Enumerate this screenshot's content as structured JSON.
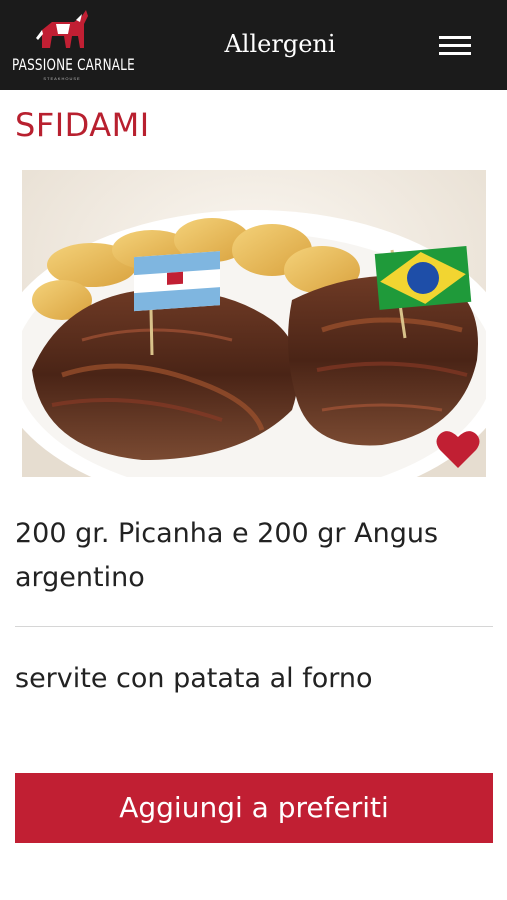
{
  "header": {
    "logo_text": "PASSIONE CARNALE",
    "logo_subtext": "STEAKHOUSE",
    "title": "Allergeni",
    "menu_icon": "hamburger-menu-icon"
  },
  "product": {
    "title": "SFIDAMI",
    "image_alt": "Picanha e Angus argentino con patate al forno",
    "favorite_icon": "heart-icon",
    "description": "200 gr. Picanha e 200 gr Angus argentino",
    "note": "servite con patata al forno",
    "add_button_label": "Aggiungi a preferiti"
  },
  "colors": {
    "header_bg": "#1b1b1b",
    "accent": "#c11f33",
    "title_red": "#b8202f"
  }
}
